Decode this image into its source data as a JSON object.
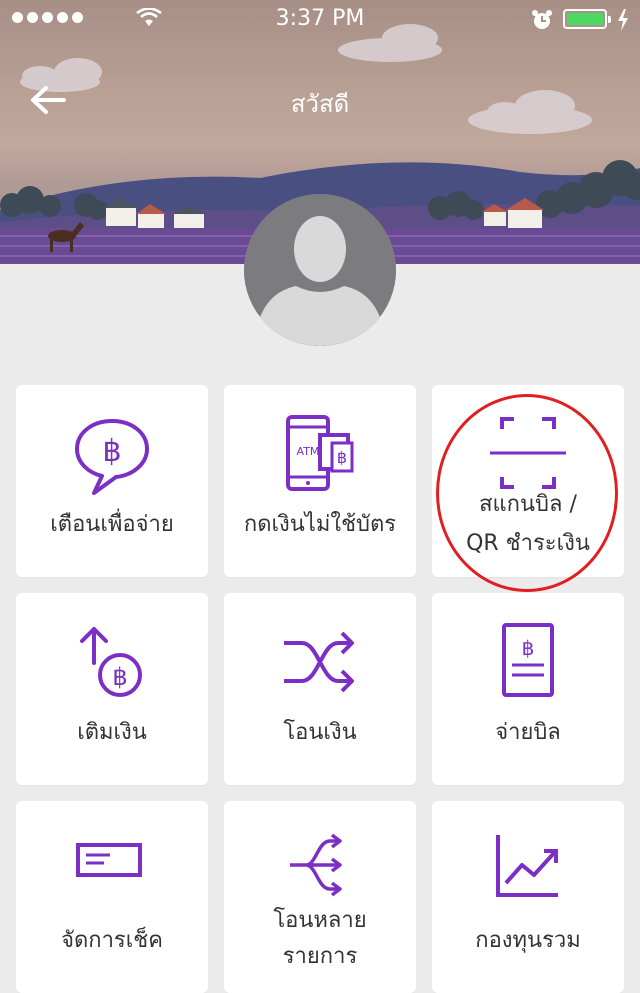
{
  "status_bar": {
    "time": "3:37 PM",
    "battery_color": "#4cd964"
  },
  "header": {
    "title": "สวัสดี",
    "back_icon": "arrow-left-icon"
  },
  "accent_color": "#7b2fc4",
  "menu": [
    {
      "label": "เตือนเพื่อจ่าย",
      "icon": "chat-baht-icon"
    },
    {
      "label": "กดเงินไม่ใช้บัตร",
      "icon": "atm-phone-icon"
    },
    {
      "label_line1": "สแกนบิล /",
      "label_line2": "QR ชำระเงิน",
      "icon": "scan-icon"
    },
    {
      "label": "เติมเงิน",
      "icon": "topup-icon"
    },
    {
      "label": "โอนเงิน",
      "icon": "shuffle-transfer-icon"
    },
    {
      "label": "จ่ายบิล",
      "icon": "bill-icon"
    },
    {
      "label": "จัดการเช็ค",
      "icon": "cheque-icon"
    },
    {
      "label_line1": "โอนหลาย",
      "label_line2": "รายการ",
      "icon": "multi-transfer-icon"
    },
    {
      "label": "กองทุนรวม",
      "icon": "chart-up-icon"
    }
  ]
}
